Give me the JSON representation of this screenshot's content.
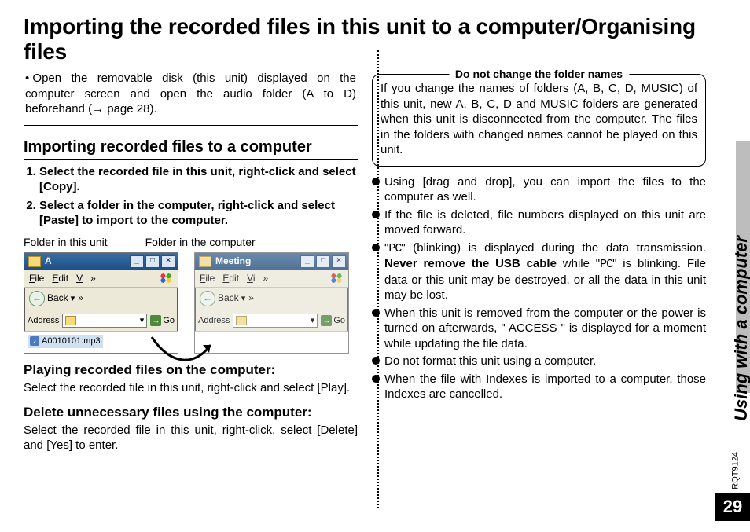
{
  "title": "Importing the recorded files in this unit to a computer/Organising files",
  "intro": "Open the removable disk (this unit) displayed on the computer screen and open the audio folder (A to D) beforehand (→ page 28).",
  "left": {
    "h2": "Importing recorded files to a computer",
    "steps": [
      "Select the recorded file in this unit, right-click and select [Copy].",
      "Select a folder in the computer, right-click and select [Paste] to import to the computer."
    ],
    "caption1": "Folder in this unit",
    "caption2": "Folder in the computer",
    "win1": {
      "title": "A",
      "menu": {
        "file": "File",
        "edit": "Edit",
        "view": "V",
        "more": "»"
      },
      "back": "Back",
      "backdrop": "▾",
      "address": "Address",
      "go": "Go",
      "filename": "A0010101.mp3"
    },
    "win2": {
      "title": "Meeting",
      "menu": {
        "file": "File",
        "edit": "Edit",
        "view": "Vi",
        "more": "»"
      },
      "back": "Back",
      "backdrop": "▾",
      "address": "Address",
      "go": "Go"
    },
    "h3a": "Playing recorded files on the computer:",
    "p_a": "Select the recorded file in this unit, right-click and select [Play].",
    "h3b": "Delete unnecessary files using the computer:",
    "p_b": "Select the recorded file in this unit, right-click, select [Delete] and [Yes] to enter."
  },
  "right": {
    "note_title": "Do not change the folder names",
    "note_body": "If you change the names of folders (A, B, C, D, MUSIC) of this unit, new A, B, C, D and MUSIC folders are generated when this unit is disconnected from the computer. The files in the folders with changed names cannot be played on this unit.",
    "bullets": [
      "Using [drag and drop], you can import the files to the computer as well.",
      "If the file is deleted, file numbers displayed on this unit are moved forward.",
      "\"PC\" (blinking) is displayed during the data transmission. Never remove the USB cable while \"PC\" is blinking. File data or this unit may be destroyed, or all the data in this unit may be lost.",
      "When this unit is removed from the computer or the power is turned on afterwards, \" ACCESS \" is displayed for a moment while updating the file data.",
      "Do not format this unit using a computer.",
      "When the file with Indexes is imported to a computer, those Indexes are cancelled."
    ],
    "bullet3_pre": "\"",
    "bullet3_pc": "PC",
    "bullet3_mid1": "\" (blinking) is displayed during the data transmission. ",
    "bullet3_bold": "Never remove the USB cable",
    "bullet3_mid2": " while \"",
    "bullet3_pc2": "PC",
    "bullet3_end": "\" is blinking. File data or this unit may be destroyed, or all the data in this unit may be lost."
  },
  "side": {
    "section": "Using with a computer",
    "docid": "RQT9124",
    "page": "29"
  }
}
